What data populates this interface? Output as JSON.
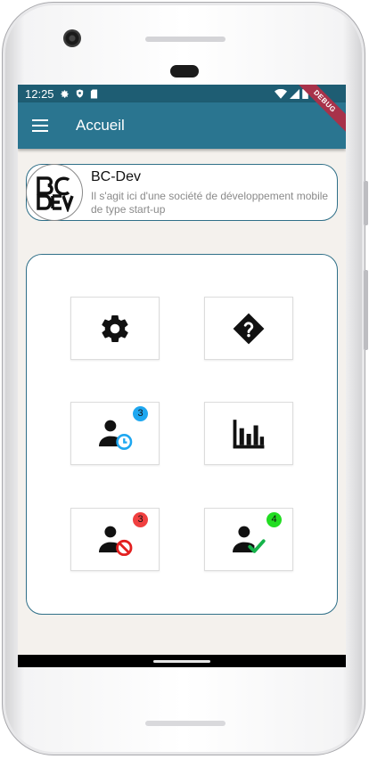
{
  "status_bar": {
    "time": "12:25",
    "icons": [
      "gear-icon",
      "shield-icon",
      "sd-card-icon",
      "wifi-icon",
      "signal-icon",
      "battery-icon"
    ]
  },
  "app_bar": {
    "title": "Accueil",
    "menu_icon": "menu-icon",
    "debug_label": "DEBUG"
  },
  "company": {
    "name": "BC-Dev",
    "description": "Il s'agit ici d'une société de développement mobile de type start-up"
  },
  "grid": {
    "tiles": [
      {
        "icon": "settings-icon",
        "badge": null
      },
      {
        "icon": "help-icon",
        "badge": null
      },
      {
        "icon": "user-pending-icon",
        "badge": "3",
        "badge_color": "#1ea7f0"
      },
      {
        "icon": "bar-chart-icon",
        "badge": null
      },
      {
        "icon": "user-blocked-icon",
        "badge": "3",
        "badge_color": "#f04040"
      },
      {
        "icon": "user-approved-icon",
        "badge": "4",
        "badge_color": "#22dd22"
      }
    ]
  },
  "colors": {
    "app_bar": "#2a7590",
    "status_bar": "#1e5d73",
    "border": "#2f6f88"
  }
}
